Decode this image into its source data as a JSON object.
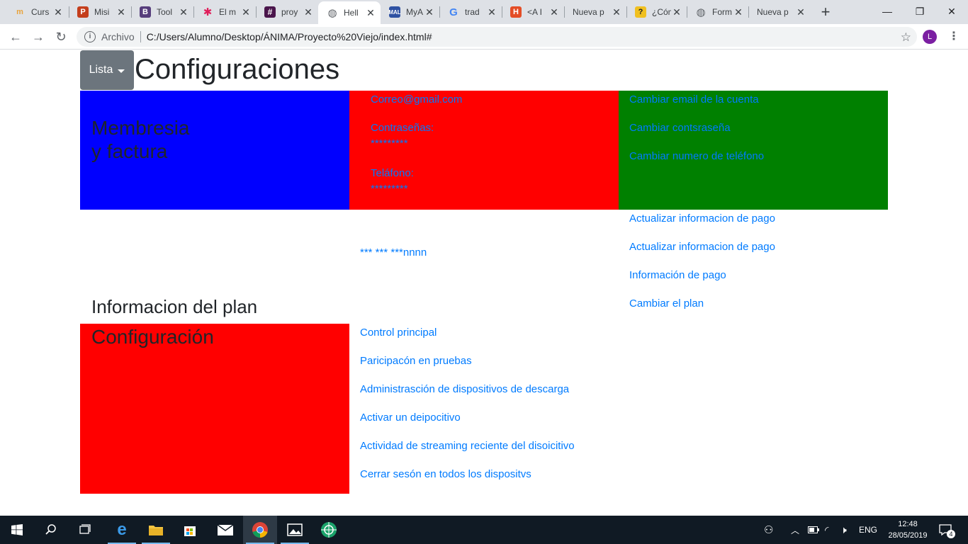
{
  "browser": {
    "tabs": [
      {
        "title": "Curs",
        "icon": "coursera-icon",
        "color": "#e8a33d"
      },
      {
        "title": "Misi",
        "icon": "powerpoint-icon",
        "color": "#c43e1c"
      },
      {
        "title": "Tool",
        "icon": "bootstrap-icon",
        "color": "#563d7c"
      },
      {
        "title": "El m",
        "icon": "slack-icon",
        "color": "#36c5f0"
      },
      {
        "title": "proy",
        "icon": "slack-icon",
        "color": "#4a154b"
      },
      {
        "title": "Hell",
        "icon": "globe-icon",
        "color": "#5f6368"
      },
      {
        "title": "MyA",
        "icon": "myanimelist-icon",
        "color": "#2e51a2"
      },
      {
        "title": "trad",
        "icon": "google-icon",
        "color": "#4285f4"
      },
      {
        "title": "<A I",
        "icon": "html-icon",
        "color": "#e44d26"
      },
      {
        "title": "Nueva p",
        "icon": "",
        "color": ""
      },
      {
        "title": "¿Cóm",
        "icon": "quiz-icon",
        "color": "#f0c020"
      },
      {
        "title": "Form",
        "icon": "globe-icon",
        "color": "#5f6368"
      },
      {
        "title": "Nueva p",
        "icon": "",
        "color": ""
      }
    ],
    "active_tab": 5,
    "new_tab_label": "+",
    "address": {
      "scheme_label": "Archivo",
      "url": "C:/Users/Alumno/Desktop/ÁNIMA/Proyecto%20Viejo/index.html#"
    },
    "profile_initial": "L"
  },
  "page": {
    "dropdown_label": "Lista",
    "title": "Configuraciones",
    "membership": {
      "heading_line1": "Membresia",
      "heading_line2": "y factura",
      "email": "Correo@gmail.com",
      "password_label": "Contraseñas:",
      "password_value": "*********",
      "phone_label": "Teláfono:",
      "phone_value": "*********",
      "actions": [
        "Cambiar email de la cuenta",
        "Cambiar contsraseña",
        "Cambiar numero de teléfono"
      ],
      "card_masked": "*** *** ***nnnn",
      "payment_actions": [
        "Actualizar informacion de pago",
        "Actualizar informacion de pago",
        "Información de pago",
        "Cambiar el plan"
      ]
    },
    "plan_heading": "Informacion del plan",
    "configuration": {
      "heading": "Configuración",
      "links": [
        "Control principal",
        "Paricipacón en pruebas",
        "Administrasción de dispositivos de descarga",
        "Activar un deipocitivo",
        "Actividad de streaming reciente del disoicitivo",
        "Cerrar sesón en todos los dispositvs"
      ]
    },
    "colors": {
      "blue_block": "#0000ff",
      "red_block": "#ff0000",
      "green_block": "#008000",
      "link": "#007bff",
      "button": "#6c757d"
    }
  },
  "taskbar": {
    "apps": [
      "start-icon",
      "search-icon",
      "task-view-icon",
      "edge-icon",
      "file-explorer-icon",
      "store-icon",
      "mail-icon",
      "chrome-icon",
      "photos-icon",
      "app-icon"
    ],
    "language": "ENG",
    "time": "12:48",
    "date": "28/05/2019",
    "notifications": "4"
  }
}
